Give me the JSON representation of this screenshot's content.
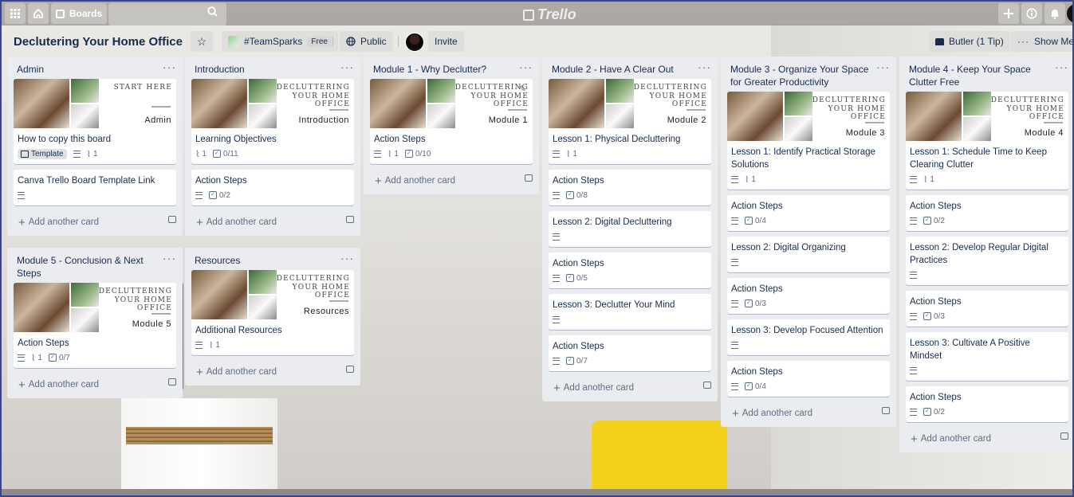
{
  "header": {
    "apps_icon": "apps-grid-icon",
    "home_icon": "home-icon",
    "boards_label": "Boards",
    "search_icon": "search-icon",
    "logo": "Trello",
    "right_icons": [
      "plus-icon",
      "info-icon",
      "bell-icon"
    ]
  },
  "board": {
    "title": "Declutering Your Home Office",
    "team": "#TeamSparks",
    "team_badge": "Free",
    "visibility": "Public",
    "invite": "Invite",
    "butler": "Butler (1 Tip)",
    "show_menu": "Show Menu"
  },
  "cover_text": {
    "start": "START HERE",
    "brand": [
      "DECLUTTERING",
      "YOUR HOME",
      "OFFICE"
    ]
  },
  "add_card_label": "Add another card",
  "lists": [
    {
      "title": "Admin",
      "cards": [
        {
          "cover": "Admin",
          "cover_style": "start",
          "title": "How to copy this board",
          "template": "Template",
          "desc": true,
          "attach": "1"
        },
        {
          "title": "Canva Trello Board Template Link",
          "desc": true
        }
      ]
    },
    {
      "title": "Introduction",
      "cards": [
        {
          "cover": "Introduction",
          "title": "Learning Objectives",
          "attach": "1",
          "check": "0/11"
        },
        {
          "title": "Action Steps",
          "desc": true,
          "check": "0/2"
        }
      ]
    },
    {
      "title": "Module 1 - Why Declutter?",
      "cards": [
        {
          "cover": "Module 1",
          "title": "Action Steps",
          "desc": true,
          "attach": "1",
          "check": "0/10",
          "edit": true
        }
      ]
    },
    {
      "title": "Module 2 - Have A Clear Out",
      "cards": [
        {
          "cover": "Module 2",
          "title": "Lesson 1: Physical Decluttering",
          "desc": true,
          "attach": "1"
        },
        {
          "title": "Action Steps",
          "desc": true,
          "check": "0/8"
        },
        {
          "title": "Lesson 2: Digital Decluttering",
          "desc": true
        },
        {
          "title": "Action Steps",
          "desc": true,
          "check": "0/5"
        },
        {
          "title": "Lesson 3: Declutter Your Mind",
          "desc": true
        },
        {
          "title": "Action Steps",
          "desc": true,
          "check": "0/7"
        }
      ]
    },
    {
      "title": "Module 3 - Organize Your Space for Greater Productivity",
      "cards": [
        {
          "cover": "Module 3",
          "title": "Lesson 1: Identify Practical Storage Solutions",
          "desc": true,
          "attach": "1"
        },
        {
          "title": "Action Steps",
          "desc": true,
          "check": "0/4"
        },
        {
          "title": "Lesson 2: Digital Organizing",
          "desc": true
        },
        {
          "title": "Action Steps",
          "desc": true,
          "check": "0/3"
        },
        {
          "title": "Lesson 3: Develop Focused Attention",
          "desc": true
        },
        {
          "title": "Action Steps",
          "desc": true,
          "check": "0/4"
        }
      ]
    },
    {
      "title": "Module 4 - Keep Your Space Clutter Free",
      "cards": [
        {
          "cover": "Module 4",
          "title": "Lesson 1: Schedule Time to Keep Clearing Clutter",
          "desc": true,
          "attach": "1"
        },
        {
          "title": "Action Steps",
          "desc": true,
          "check": "0/2"
        },
        {
          "title": "Lesson 2: Develop Regular Digital Practices",
          "desc": true
        },
        {
          "title": "Action Steps",
          "desc": true,
          "check": "0/3"
        },
        {
          "title": "Lesson 3: Cultivate A Positive Mindset",
          "desc": true
        },
        {
          "title": "Action Steps",
          "desc": true,
          "check": "0/2"
        }
      ]
    },
    {
      "title": "Module 5 - Conclusion & Next Steps",
      "cards": [
        {
          "cover": "Module 5",
          "title": "Action Steps",
          "desc": true,
          "attach": "1",
          "check": "0/7"
        }
      ]
    },
    {
      "title": "Resources",
      "cards": [
        {
          "cover": "Resources",
          "title": "Additional Resources",
          "desc": true,
          "attach": "1"
        }
      ]
    }
  ]
}
